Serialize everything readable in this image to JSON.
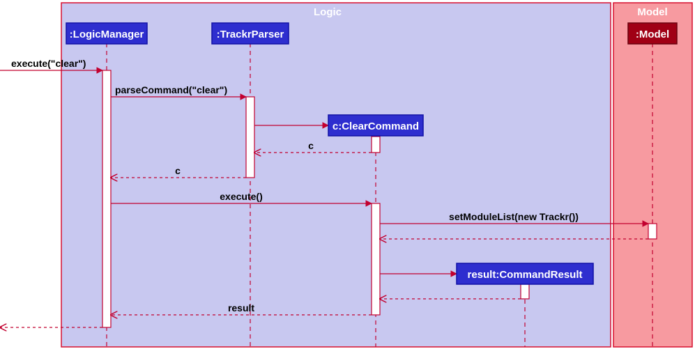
{
  "frames": {
    "logic": {
      "label": "Logic"
    },
    "model": {
      "label": "Model"
    }
  },
  "participants": {
    "logicManager": {
      "label": ":LogicManager"
    },
    "trackrParser": {
      "label": ":TrackrParser"
    },
    "clearCommand": {
      "label": "c:ClearCommand"
    },
    "commandResult": {
      "label": "result:CommandResult"
    },
    "model": {
      "label": ":Model"
    }
  },
  "messages": {
    "m1": "execute(\"clear\")",
    "m2": "parseCommand(\"clear\")",
    "m3_return": "c",
    "m4_return": "c",
    "m5": "execute()",
    "m6": "setModuleList(new Trackr())",
    "m7_return": "result"
  },
  "colors": {
    "logicFrameFill": "#c8c8f0",
    "logicFrameStroke": "#d70f2e",
    "logicParticipantFill": "#2e2ecf",
    "logicParticipantStroke": "#1010a5",
    "modelFrameFill": "#f79aa0",
    "modelFrameStroke": "#d70f2e",
    "modelParticipantFill": "#a00015",
    "modelParticipantStroke": "#6a000d",
    "line": "#c2002f",
    "lifeline": "#c2002f"
  },
  "chart_data": {
    "type": "sequence-diagram",
    "frames": [
      {
        "name": "Logic",
        "participants": [
          ":LogicManager",
          ":TrackrParser",
          "c:ClearCommand",
          "result:CommandResult"
        ]
      },
      {
        "name": "Model",
        "participants": [
          ":Model"
        ]
      }
    ],
    "messages": [
      {
        "from": "caller",
        "to": ":LogicManager",
        "label": "execute(\"clear\")",
        "kind": "sync"
      },
      {
        "from": ":LogicManager",
        "to": ":TrackrParser",
        "label": "parseCommand(\"clear\")",
        "kind": "sync"
      },
      {
        "from": ":TrackrParser",
        "to": "c:ClearCommand",
        "label": "",
        "kind": "create"
      },
      {
        "from": "c:ClearCommand",
        "to": ":TrackrParser",
        "label": "c",
        "kind": "return"
      },
      {
        "from": ":TrackrParser",
        "to": ":LogicManager",
        "label": "c",
        "kind": "return"
      },
      {
        "from": ":LogicManager",
        "to": "c:ClearCommand",
        "label": "execute()",
        "kind": "sync"
      },
      {
        "from": "c:ClearCommand",
        "to": ":Model",
        "label": "setModuleList(new Trackr())",
        "kind": "sync"
      },
      {
        "from": ":Model",
        "to": "c:ClearCommand",
        "label": "",
        "kind": "return"
      },
      {
        "from": "c:ClearCommand",
        "to": "result:CommandResult",
        "label": "",
        "kind": "create"
      },
      {
        "from": "result:CommandResult",
        "to": "c:ClearCommand",
        "label": "",
        "kind": "return"
      },
      {
        "from": "c:ClearCommand",
        "to": ":LogicManager",
        "label": "result",
        "kind": "return"
      },
      {
        "from": ":LogicManager",
        "to": "caller",
        "label": "",
        "kind": "return"
      }
    ]
  }
}
